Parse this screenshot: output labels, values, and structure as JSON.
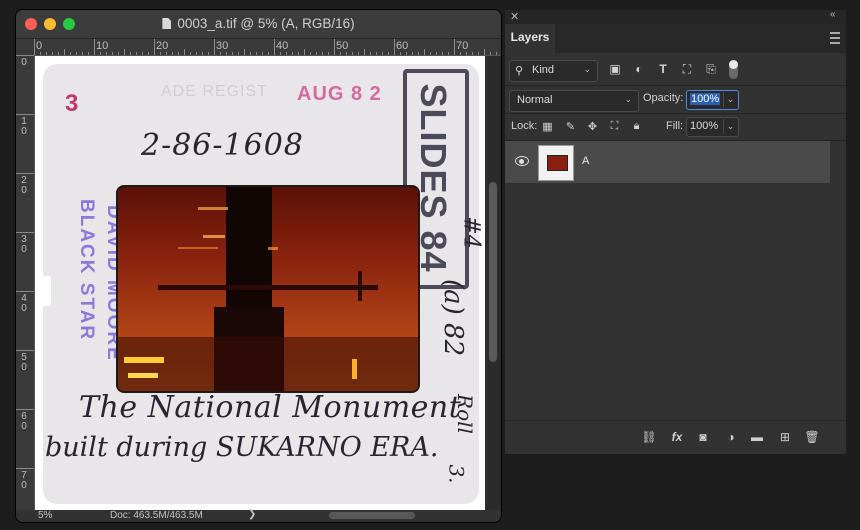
{
  "document": {
    "title": "0003_a.tif @ 5% (A, RGB/16)",
    "ruler_top_labels": [
      "0",
      "10",
      "20",
      "30",
      "40",
      "50",
      "60",
      "70"
    ],
    "ruler_left_labels": [
      "0",
      "1\n0",
      "2\n0",
      "3\n0",
      "4\n0",
      "5\n0",
      "6\n0",
      "7\n0"
    ],
    "status": {
      "zoom": "5%",
      "doc_size": "Doc: 463.5M/463.5M",
      "chevron": "❯"
    }
  },
  "slide": {
    "stamp_number": "3",
    "faded_stamp": "ADE   REGIST",
    "date_stamp": "AUG 8 2",
    "slides_stamp": "SLIDES 84",
    "handwritten_code": "2-86-1608",
    "credit_line1": "DAVID MOORE",
    "credit_line2": "BLACK STAR",
    "side_note": "#4",
    "side_date": "(a) 82",
    "roll_note": "Roll",
    "corner_note": "3.",
    "caption_line1": "The National Monument",
    "caption_line2": "built during SUKARNO ERA."
  },
  "layers_panel": {
    "tab": "Layers",
    "kind_label": "Kind",
    "blend_mode": "Normal",
    "opacity_label": "Opacity:",
    "opacity_value": "100%",
    "lock_label": "Lock:",
    "fill_label": "Fill:",
    "fill_value": "100%",
    "layers": [
      {
        "name": "A",
        "visible": true
      }
    ]
  },
  "colors": {
    "accent": "#2d5fb0",
    "stamp_pink": "#c0396e",
    "stamp_gray": "#4a4a58",
    "stamp_violet": "#8a7ad8"
  }
}
